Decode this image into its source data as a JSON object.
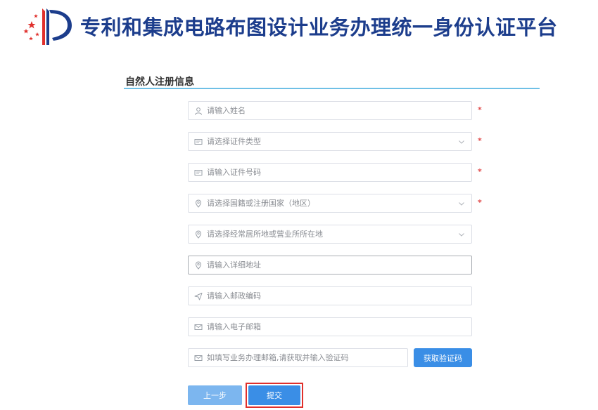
{
  "header": {
    "title": "专利和集成电路布图设计业务办理统一身份认证平台"
  },
  "section": {
    "title": "自然人注册信息"
  },
  "form": {
    "name": {
      "placeholder": "请输入姓名"
    },
    "id_type": {
      "placeholder": "请选择证件类型"
    },
    "id_number": {
      "placeholder": "请输入证件号码"
    },
    "nationality": {
      "placeholder": "请选择国籍或注册国家（地区）"
    },
    "residence": {
      "placeholder": "请选择经常居所地或营业所所在地"
    },
    "address": {
      "placeholder": "请输入详细地址"
    },
    "postal_code": {
      "placeholder": "请输入邮政编码"
    },
    "email": {
      "placeholder": "请输入电子邮箱"
    },
    "verify_code": {
      "placeholder": "如填写业务办理邮箱,请获取并输入验证码"
    },
    "required_mark": "*",
    "get_code_label": "获取验证码"
  },
  "actions": {
    "prev_label": "上一步",
    "submit_label": "提交"
  },
  "colors": {
    "title": "#1c3d8c",
    "accent": "#3a8ee6",
    "highlight": "#e0302c",
    "required": "#e14b4b"
  }
}
